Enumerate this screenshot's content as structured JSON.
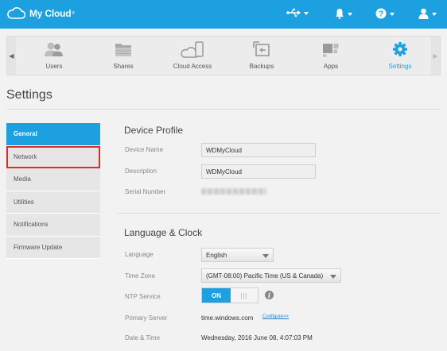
{
  "app": {
    "title": "My Cloud",
    "trademark": "®"
  },
  "colors": {
    "accent": "#1ca0e0",
    "highlight_border": "#e02b2b"
  },
  "topbar_icons": [
    "usb-icon",
    "bell-icon",
    "help-icon",
    "user-icon"
  ],
  "nav": {
    "items": [
      {
        "label": "Users",
        "icon": "users-icon"
      },
      {
        "label": "Shares",
        "icon": "shares-icon"
      },
      {
        "label": "Cloud Access",
        "icon": "cloud-access-icon"
      },
      {
        "label": "Backups",
        "icon": "backups-icon"
      },
      {
        "label": "Apps",
        "icon": "apps-icon"
      },
      {
        "label": "Settings",
        "icon": "gear-icon",
        "active": true
      }
    ]
  },
  "page": {
    "title": "Settings"
  },
  "sidebar": {
    "items": [
      {
        "label": "General",
        "active": true
      },
      {
        "label": "Network",
        "highlighted": true
      },
      {
        "label": "Media"
      },
      {
        "label": "Utilities"
      },
      {
        "label": "Notifications"
      },
      {
        "label": "Firmware Update"
      }
    ]
  },
  "device_profile": {
    "heading": "Device Profile",
    "device_name_label": "Device Name",
    "device_name_value": "WDMyCloud",
    "description_label": "Description",
    "description_value": "WDMyCloud",
    "serial_label": "Serial Number"
  },
  "language_clock": {
    "heading": "Language & Clock",
    "language_label": "Language",
    "language_value": "English",
    "timezone_label": "Time Zone",
    "timezone_value": "(GMT-08:00) Pacific Time (US & Canada)",
    "ntp_label": "NTP Service",
    "ntp_on": "ON",
    "ntp_off": "|||",
    "primary_server_label": "Primary Server",
    "primary_server_value": "time.windows.com",
    "configure_link": "Configure>>",
    "datetime_label": "Date & Time",
    "datetime_value": "Wednesday, 2016 June 08, 4:07:03 PM"
  }
}
